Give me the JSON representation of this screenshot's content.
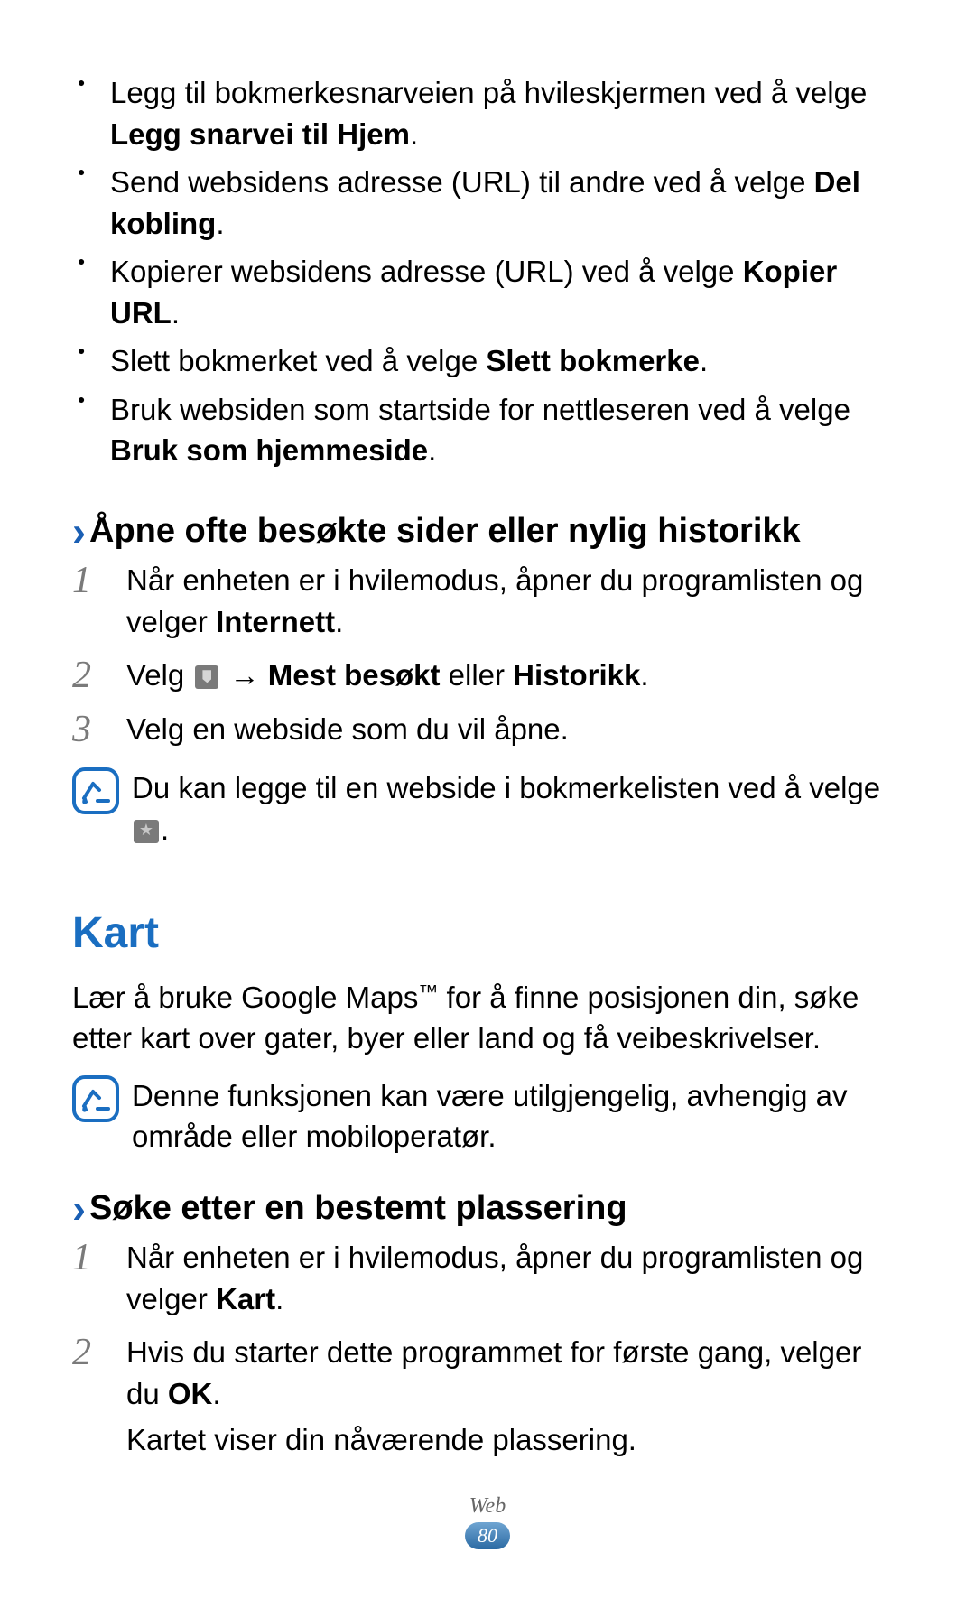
{
  "bullets": [
    {
      "pre": "Legg til bokmerkesnarveien på hvileskjermen ved å velge ",
      "bold": "Legg snarvei til Hjem",
      "post": "."
    },
    {
      "pre": "Send websidens adresse (URL) til andre ved å velge ",
      "bold": "Del kobling",
      "post": "."
    },
    {
      "pre": "Kopierer websidens adresse (URL) ved å velge ",
      "bold": "Kopier URL",
      "post": "."
    },
    {
      "pre": "Slett bokmerket ved å velge ",
      "bold": "Slett bokmerke",
      "post": "."
    },
    {
      "pre": "Bruk websiden som startside for nettleseren ved å velge ",
      "bold": "Bruk som hjemmeside",
      "post": "."
    }
  ],
  "section1_title": "Åpne ofte besøkte sider eller nylig historikk",
  "steps1": {
    "s1_pre": "Når enheten er i hvilemodus, åpner du programlisten og velger ",
    "s1_bold": "Internett",
    "s1_post": ".",
    "s2_pre": "Velg ",
    "s2_arrow": " → ",
    "s2_bold": "Mest besøkt",
    "s2_mid": " eller ",
    "s2_bold2": "Historikk",
    "s2_post": ".",
    "s3": "Velg en webside som du vil åpne."
  },
  "note1_pre": "Du kan legge til en webside i bokmerkelisten ved å velge ",
  "note1_post": ".",
  "h1": "Kart",
  "intro_pre": "Lær å bruke Google Maps",
  "intro_tm": "™",
  "intro_post": " for å finne posisjonen din, søke etter kart over gater, byer eller land og få veibeskrivelser.",
  "note2": "Denne funksjonen kan være utilgjengelig, avhengig av område eller mobiloperatør.",
  "section2_title": "Søke etter en bestemt plassering",
  "steps2": {
    "s1_pre": "Når enheten er i hvilemodus, åpner du programlisten og velger ",
    "s1_bold": "Kart",
    "s1_post": ".",
    "s2_pre": "Hvis du starter dette programmet for første gang, velger du ",
    "s2_bold": "OK",
    "s2_post": ".",
    "s2_extra": "Kartet viser din nåværende plassering."
  },
  "footer": {
    "section": "Web",
    "page": "80"
  },
  "chevron": "›"
}
